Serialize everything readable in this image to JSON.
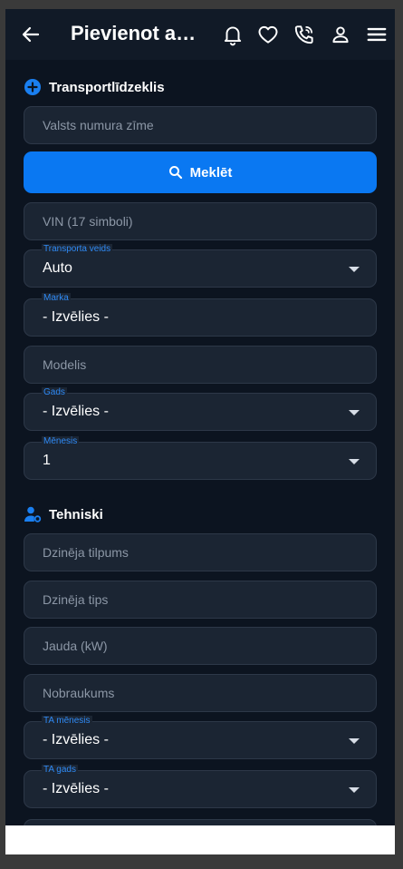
{
  "header": {
    "title": "Pievienot auto",
    "icons": [
      "back-arrow-icon",
      "bell-icon",
      "heart-icon",
      "phone-icon",
      "user-icon",
      "menu-icon"
    ]
  },
  "vehicle_section": {
    "title": "Transportlīdzeklis",
    "plate": {
      "placeholder": "Valsts numura zīme"
    },
    "search_button": "Meklēt",
    "vin": {
      "placeholder": "VIN (17 simboli)"
    },
    "transport_type": {
      "label": "Transporta veids",
      "value": "Auto"
    },
    "brand": {
      "label": "Marka",
      "value": "- Izvēlies -"
    },
    "model": {
      "placeholder": "Modelis"
    },
    "year": {
      "label": "Gads",
      "value": "- Izvēlies -"
    },
    "month": {
      "label": "Mēnesis",
      "value": "1"
    }
  },
  "technical_section": {
    "title": "Tehniski",
    "engine_volume": {
      "placeholder": "Dzinēja tilpums"
    },
    "engine_type": {
      "placeholder": "Dzinēja tips"
    },
    "power": {
      "placeholder": "Jauda (kW)"
    },
    "mileage": {
      "placeholder": "Nobraukums"
    },
    "inspection_month": {
      "label": "TA mēnesis",
      "value": "- Izvēlies -"
    },
    "inspection_year": {
      "label": "TA gads",
      "value": "- Izvēlies -"
    }
  },
  "colors": {
    "background": "#0c1420",
    "field": "#1b2533",
    "accent": "#0a78f2",
    "label": "#2f8af5"
  }
}
